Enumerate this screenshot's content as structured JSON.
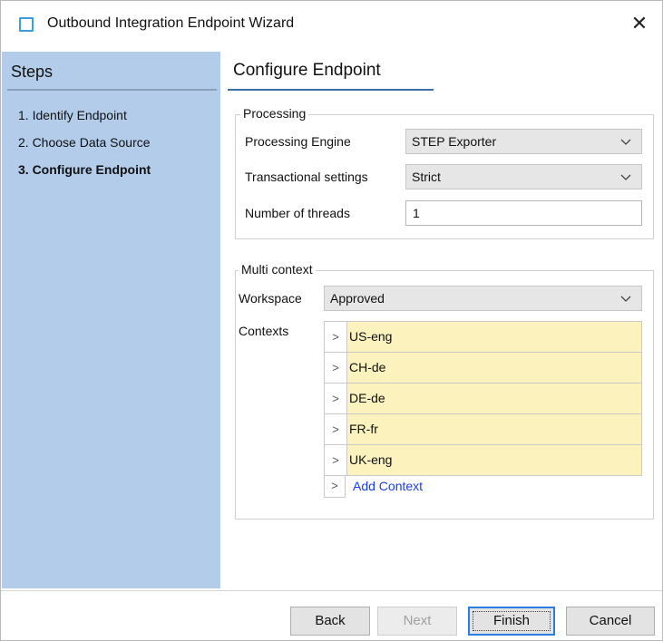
{
  "window": {
    "title": "Outbound Integration Endpoint Wizard",
    "close_glyph": "✕",
    "icon": "window-icon"
  },
  "sidebar": {
    "title": "Steps",
    "items": [
      {
        "label": "1. Identify Endpoint",
        "active": false
      },
      {
        "label": "2. Choose Data Source",
        "active": false
      },
      {
        "label": "3. Configure Endpoint",
        "active": true
      }
    ]
  },
  "main": {
    "title": "Configure Endpoint",
    "processing": {
      "legend": "Processing",
      "engine_label": "Processing Engine",
      "engine_value": "STEP Exporter",
      "transactional_label": "Transactional settings",
      "transactional_value": "Strict",
      "threads_label": "Number of threads",
      "threads_value": "1"
    },
    "multi_context": {
      "legend": "Multi context",
      "workspace_label": "Workspace",
      "workspace_value": "Approved",
      "contexts_label": "Contexts",
      "contexts": [
        "US-eng",
        "CH-de",
        "DE-de",
        "FR-fr",
        "UK-eng"
      ],
      "add_label": "Add Context",
      "row_arrow": ">"
    }
  },
  "buttons": {
    "back": "Back",
    "next": "Next",
    "finish": "Finish",
    "cancel": "Cancel"
  },
  "colors": {
    "sidebar_bg": "#b2ccea",
    "context_cell_bg": "#fbf2bd",
    "link": "#1a3ee8",
    "accent": "#2a7de1"
  }
}
